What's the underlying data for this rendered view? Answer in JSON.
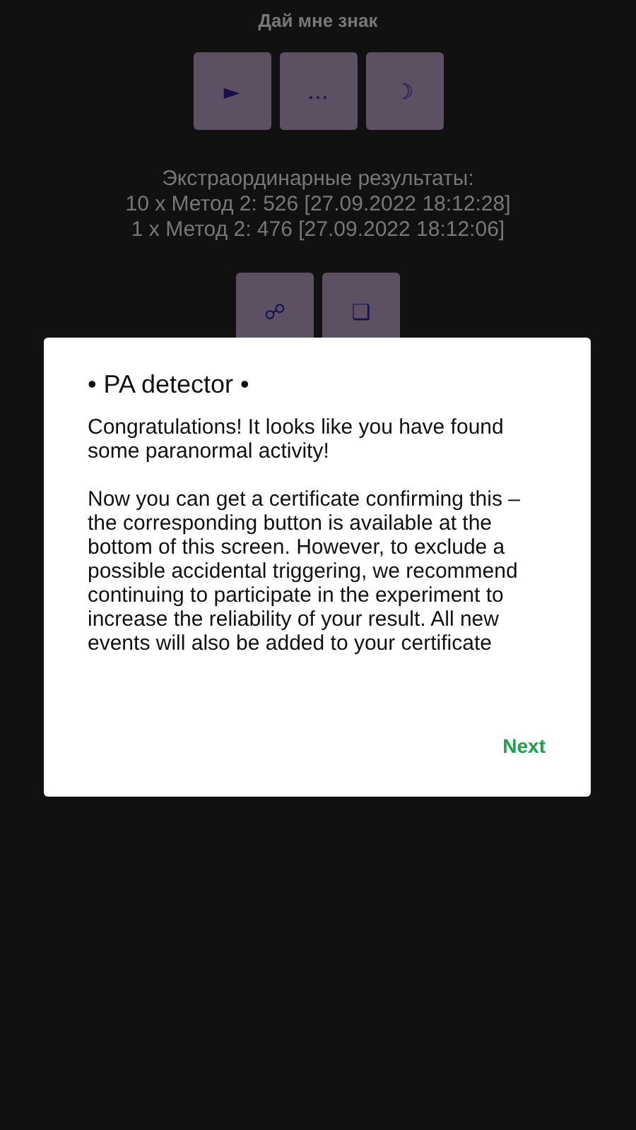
{
  "screen": {
    "title": "Дай мне знак",
    "top_buttons": [
      "►",
      "…",
      "☽"
    ],
    "results": {
      "heading": "Экстраординарные результаты:",
      "lines": [
        "10 x Метод 2: 526 [27.09.2022 18:12:28]",
        "1 x Метод 2: 476 [27.09.2022 18:12:06]"
      ]
    },
    "bottom_buttons": [
      "☍",
      "❏"
    ]
  },
  "dialog": {
    "title": "• PA detector •",
    "paragraphs": [
      "Congratulations! It looks like you have found some paranormal activity!",
      "Now you can get a certificate confirming this – the corresponding button is available at the bottom of this screen. However, to exclude a possible accidental triggering, we recommend continuing to participate in the experiment to increase the reliability of your result. All new events will also be added to your certificate"
    ],
    "button": "Next"
  }
}
